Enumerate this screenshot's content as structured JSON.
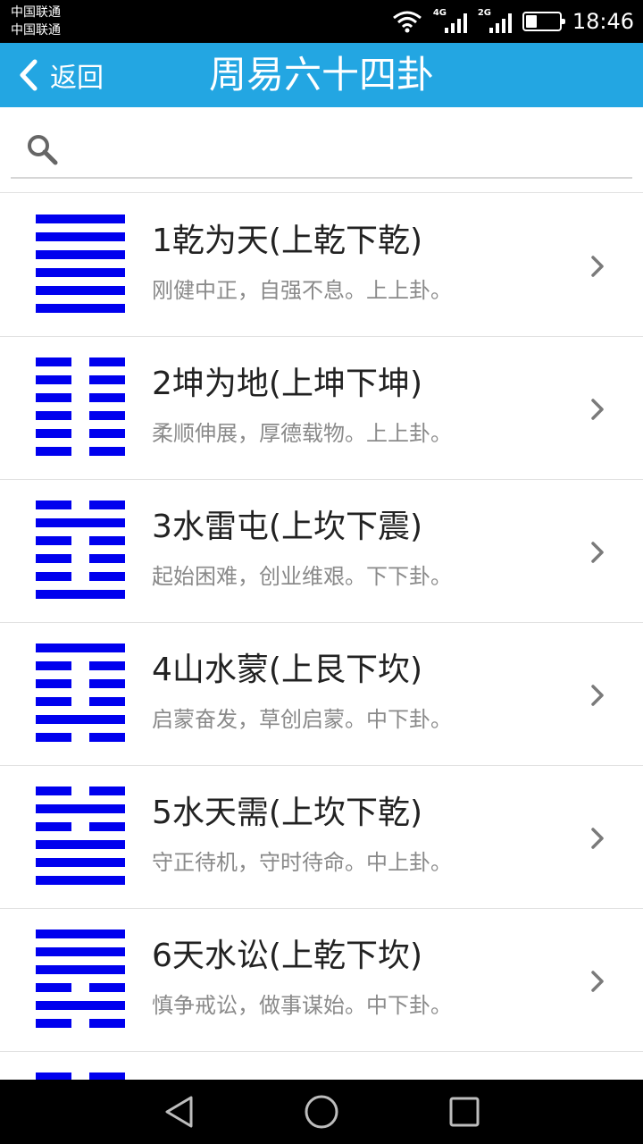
{
  "status_bar": {
    "carriers": [
      "中国联通",
      "中国联通"
    ],
    "network_1": "4G",
    "network_2": "2G",
    "time": "18:46",
    "battery_level": 0.35
  },
  "header": {
    "back_label": "返回",
    "title": "周易六十四卦"
  },
  "search": {
    "placeholder": "",
    "value": ""
  },
  "colors": {
    "header_bg": "#23a6e2",
    "hexagram_line": "#0000ee"
  },
  "hexagrams": [
    {
      "title": "1乾为天(上乾下乾)",
      "desc": "刚健中正，自强不息。上上卦。",
      "lines": [
        1,
        1,
        1,
        1,
        1,
        1
      ]
    },
    {
      "title": "2坤为地(上坤下坤)",
      "desc": "柔顺伸展，厚德载物。上上卦。",
      "lines": [
        0,
        0,
        0,
        0,
        0,
        0
      ]
    },
    {
      "title": "3水雷屯(上坎下震)",
      "desc": "起始困难，创业维艰。下下卦。",
      "lines": [
        0,
        1,
        0,
        0,
        0,
        1
      ]
    },
    {
      "title": "4山水蒙(上艮下坎)",
      "desc": "启蒙奋发，草创启蒙。中下卦。",
      "lines": [
        1,
        0,
        0,
        0,
        1,
        0
      ]
    },
    {
      "title": "5水天需(上坎下乾)",
      "desc": "守正待机，守时待命。中上卦。",
      "lines": [
        0,
        1,
        0,
        1,
        1,
        1
      ]
    },
    {
      "title": "6天水讼(上乾下坎)",
      "desc": "慎争戒讼，做事谋始。中下卦。",
      "lines": [
        1,
        1,
        1,
        0,
        1,
        0
      ]
    },
    {
      "title": "",
      "desc": "",
      "lines": [
        0,
        1,
        0,
        0,
        0,
        0
      ]
    }
  ]
}
